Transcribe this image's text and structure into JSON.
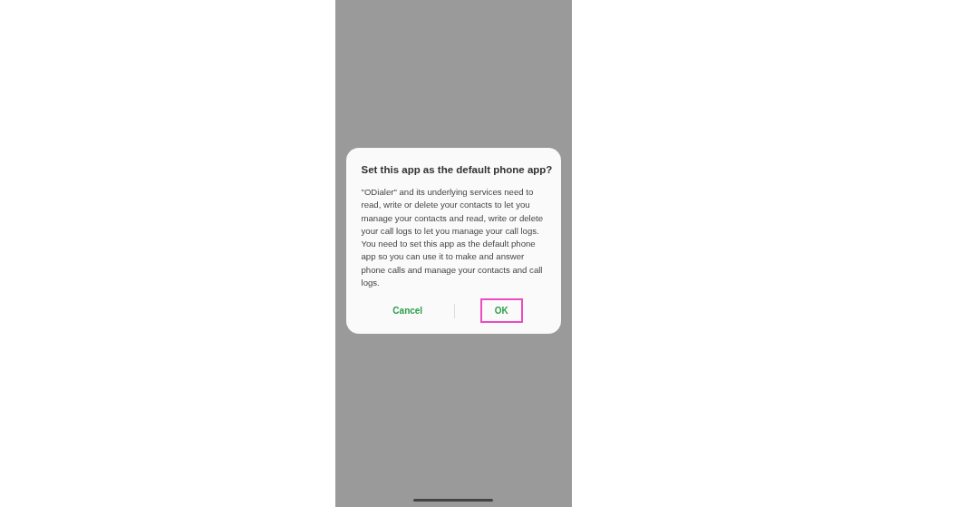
{
  "dialog": {
    "title": "Set this app as the default phone app?",
    "paragraphs": [
      "\"ODialer\" and its underlying services need to read, write or delete your contacts to let you manage your contacts and read, write or delete your call logs to let you manage your call logs.",
      "You need to set this app as the default phone app so you can use it to make and answer phone calls and manage your contacts and call logs."
    ],
    "buttons": [
      {
        "label": "Cancel",
        "highlighted": false
      },
      {
        "label": "OK",
        "highlighted": true
      }
    ]
  }
}
